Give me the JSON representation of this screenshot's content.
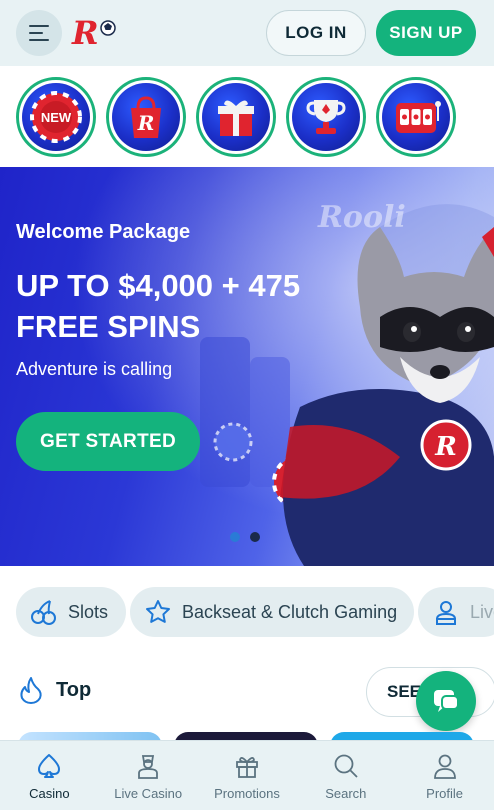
{
  "header": {
    "login_label": "LOG IN",
    "signup_label": "SIGN UP",
    "logo_icon": "rooli-logo-icon"
  },
  "stories": [
    {
      "icon": "new-chip-icon",
      "text": "NEW"
    },
    {
      "icon": "shopping-bag-icon"
    },
    {
      "icon": "gift-box-icon"
    },
    {
      "icon": "trophy-icon"
    },
    {
      "icon": "slot-machine-icon"
    }
  ],
  "banner": {
    "welcome": "Welcome Package",
    "headline": "UP TO $4,000 + 475 FREE SPINS",
    "subtitle": "Adventure is calling",
    "cta_label": "GET STARTED",
    "watermark": "Rooli",
    "chip_letter": "R",
    "slides": 2,
    "active_slide": 1
  },
  "categories": [
    {
      "label": "Slots",
      "icon": "cherries-icon"
    },
    {
      "label": "Backseat & Clutch Gaming",
      "icon": "star-icon"
    },
    {
      "label": "Live",
      "icon": "dealer-icon"
    }
  ],
  "top_section": {
    "title": "Top",
    "see_all_label": "SEE",
    "icon": "flame-icon",
    "chat_icon": "chat-icon"
  },
  "bottom_nav": [
    {
      "label": "Casino",
      "icon": "spade-icon",
      "active": true
    },
    {
      "label": "Live Casino",
      "icon": "dealer-icon",
      "active": false
    },
    {
      "label": "Promotions",
      "icon": "gift-icon",
      "active": false
    },
    {
      "label": "Search",
      "icon": "search-icon",
      "active": false
    },
    {
      "label": "Profile",
      "icon": "profile-icon",
      "active": false
    }
  ],
  "colors": {
    "accent": "#14b37d",
    "header_bg": "#e8f2f4",
    "banner_blue": "#2b38d6",
    "text_dark": "#0f2a36"
  }
}
